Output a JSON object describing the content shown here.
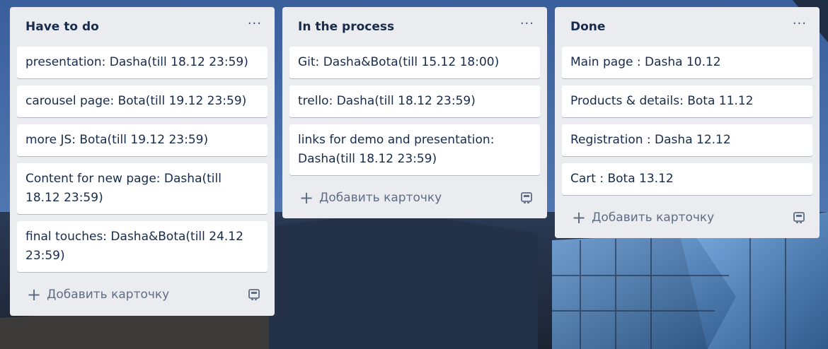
{
  "lists": [
    {
      "title": "Have to do",
      "menu": "···",
      "cards": [
        "presentation: Dasha(till 18.12 23:59)",
        "carousel page: Bota(till 19.12 23:59)",
        "more JS: Bota(till 19.12 23:59)",
        "Content for new page: Dasha(till 18.12 23:59)",
        "final touches: Dasha&Bota(till 24.12 23:59)"
      ],
      "add_label": "Добавить карточку"
    },
    {
      "title": "In the process",
      "menu": "···",
      "cards": [
        "Git: Dasha&Bota(till 15.12 18:00)",
        "trello: Dasha(till 18.12 23:59)",
        "links for demo and presentation: Dasha(till 18.12 23:59)"
      ],
      "add_label": "Добавить карточку"
    },
    {
      "title": "Done",
      "menu": "···",
      "cards": [
        "Main page : Dasha 10.12",
        "Products & details: Bota 11.12",
        "Registration : Dasha 12.12",
        "Cart : Bota 13.12"
      ],
      "add_label": "Добавить карточку"
    }
  ],
  "icons": {
    "add": "plus-icon",
    "template": "card-template-icon",
    "menu": "ellipsis-icon"
  },
  "colors": {
    "list_bg": "#ebecf0",
    "card_bg": "#ffffff",
    "title_text": "#172b4d",
    "muted_text": "#5e6c84"
  }
}
